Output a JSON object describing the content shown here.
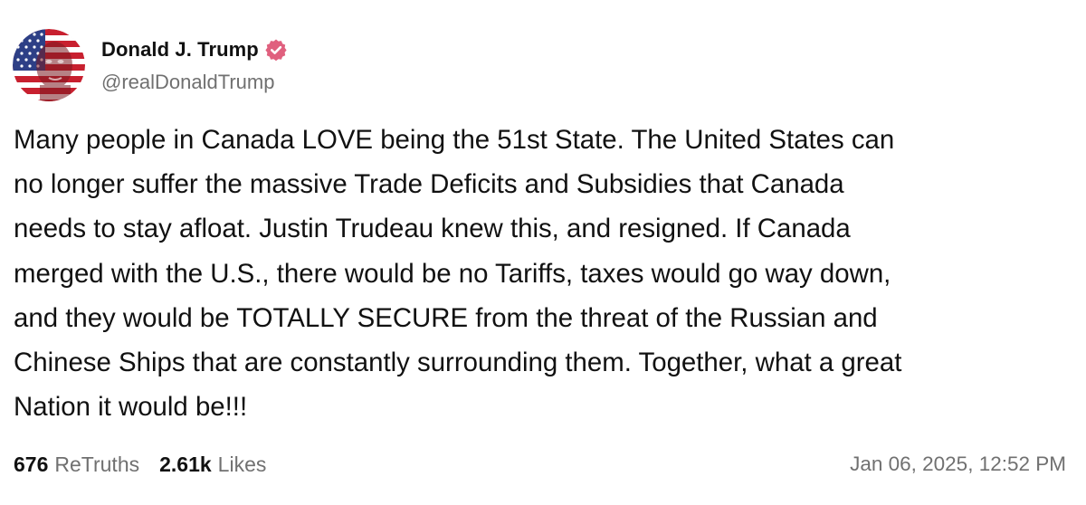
{
  "author": {
    "display_name": "Donald J. Trump",
    "handle": "@realDonaldTrump",
    "verified": true,
    "verified_badge_color": "#e0607e",
    "avatar_icon": "flag-portrait-avatar"
  },
  "post": {
    "text": "Many people in Canada LOVE being the 51st State. The United States can\nno longer suffer the massive Trade Deficits and Subsidies that Canada\nneeds to stay afloat. Justin Trudeau knew this, and resigned. If Canada\nmerged with the U.S., there would be no Tariffs, taxes would go way down,\nand they would be TOTALLY SECURE from the threat of the Russian and\nChinese Ships that are constantly surrounding them. Together, what a great\nNation it would be!!!"
  },
  "stats": {
    "retruths_count": "676",
    "retruths_label": "ReTruths",
    "likes_count": "2.61k",
    "likes_label": "Likes"
  },
  "timestamp": "Jan 06, 2025, 12:52 PM",
  "colors": {
    "text": "#111111",
    "muted": "#707070",
    "background": "#ffffff"
  }
}
